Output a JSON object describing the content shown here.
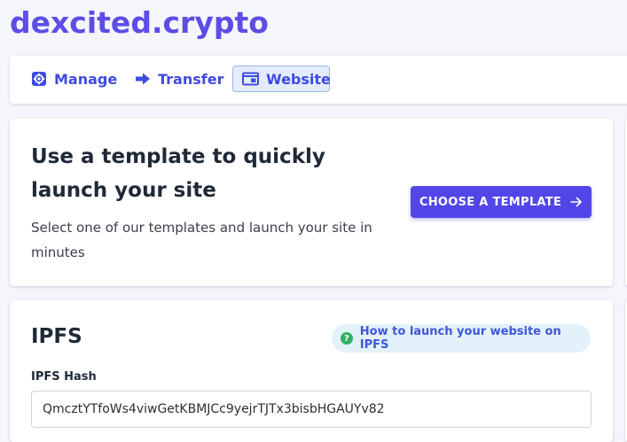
{
  "site": {
    "domain": "dexcited.crypto"
  },
  "tabs": [
    {
      "label": "Manage",
      "icon": "gear-icon",
      "active": false
    },
    {
      "label": "Transfer",
      "icon": "arrow-right-icon",
      "active": false
    },
    {
      "label": "Website",
      "icon": "browser-window-icon",
      "active": true
    }
  ],
  "template_card": {
    "heading": "Use a template to quickly launch your site",
    "description": "Select one of our templates and launch your site in minutes",
    "button_label": "CHOOSE A TEMPLATE"
  },
  "ipfs": {
    "title": "IPFS",
    "help_link": "How to launch your website on IPFS",
    "hash_label": "IPFS Hash",
    "hash_value": "QmcztYTfoWs4viwGetKBMJCc9yejrTJTx3bisbHGAUYv82"
  },
  "colors": {
    "brand": "#5b4de6",
    "accent_button": "#5246e8",
    "tab_text": "#3f4be0",
    "help_pill_bg": "#e3f1fb",
    "help_icon": "#2fb15d"
  }
}
